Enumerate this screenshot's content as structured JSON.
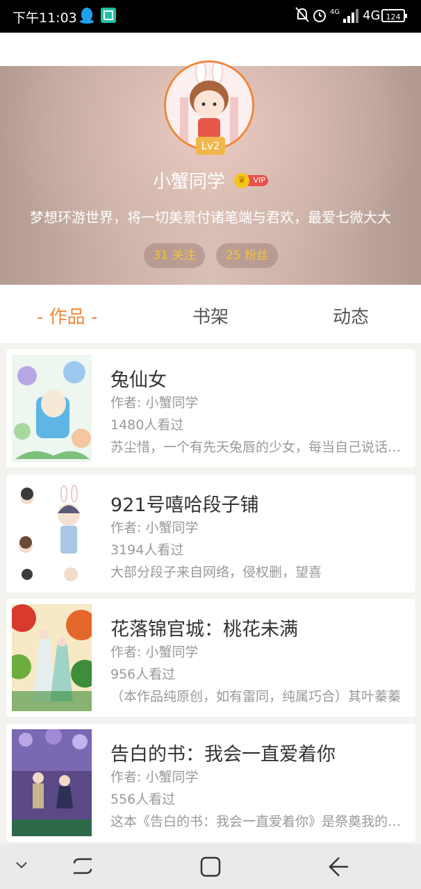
{
  "status_bar": {
    "time": "下午11:03",
    "network_small": "4G",
    "network": "4G",
    "battery": "124"
  },
  "profile": {
    "level": "Lv2",
    "username": "小蟹同学",
    "vip_label": "VIP",
    "bio": "梦想环游世界，将一切美景付诸笔端与君欢，最爱七微大大",
    "following": "31 关注",
    "followers": "25 粉丝"
  },
  "tabs": [
    "- 作品 -",
    "书架",
    "动态"
  ],
  "books": [
    {
      "title": "兔仙女",
      "author": "作者: 小蟹同学",
      "views": "1480人看过",
      "desc": "苏尘惜，一个有先天兔唇的少女，每当自己说话的时候"
    },
    {
      "title": "921号嘻哈段子铺",
      "author": "作者: 小蟹同学",
      "views": "3194人看过",
      "desc": "大部分段子来自网络，侵权删，望喜"
    },
    {
      "title": "花落锦官城：桃花未满",
      "author": "作者: 小蟹同学",
      "views": "956人看过",
      "desc": "（本作品纯原创，如有雷同，纯属巧合）其叶蓁蓁"
    },
    {
      "title": "告白的书：我会一直爱着你",
      "author": "作者: 小蟹同学",
      "views": "556人看过",
      "desc": "这本《告白的书：我会一直爱着你》是祭奠我的青春"
    }
  ],
  "colors": {
    "accent": "#f0873a",
    "vip": "#e8504a",
    "gold": "#f4c33b"
  }
}
